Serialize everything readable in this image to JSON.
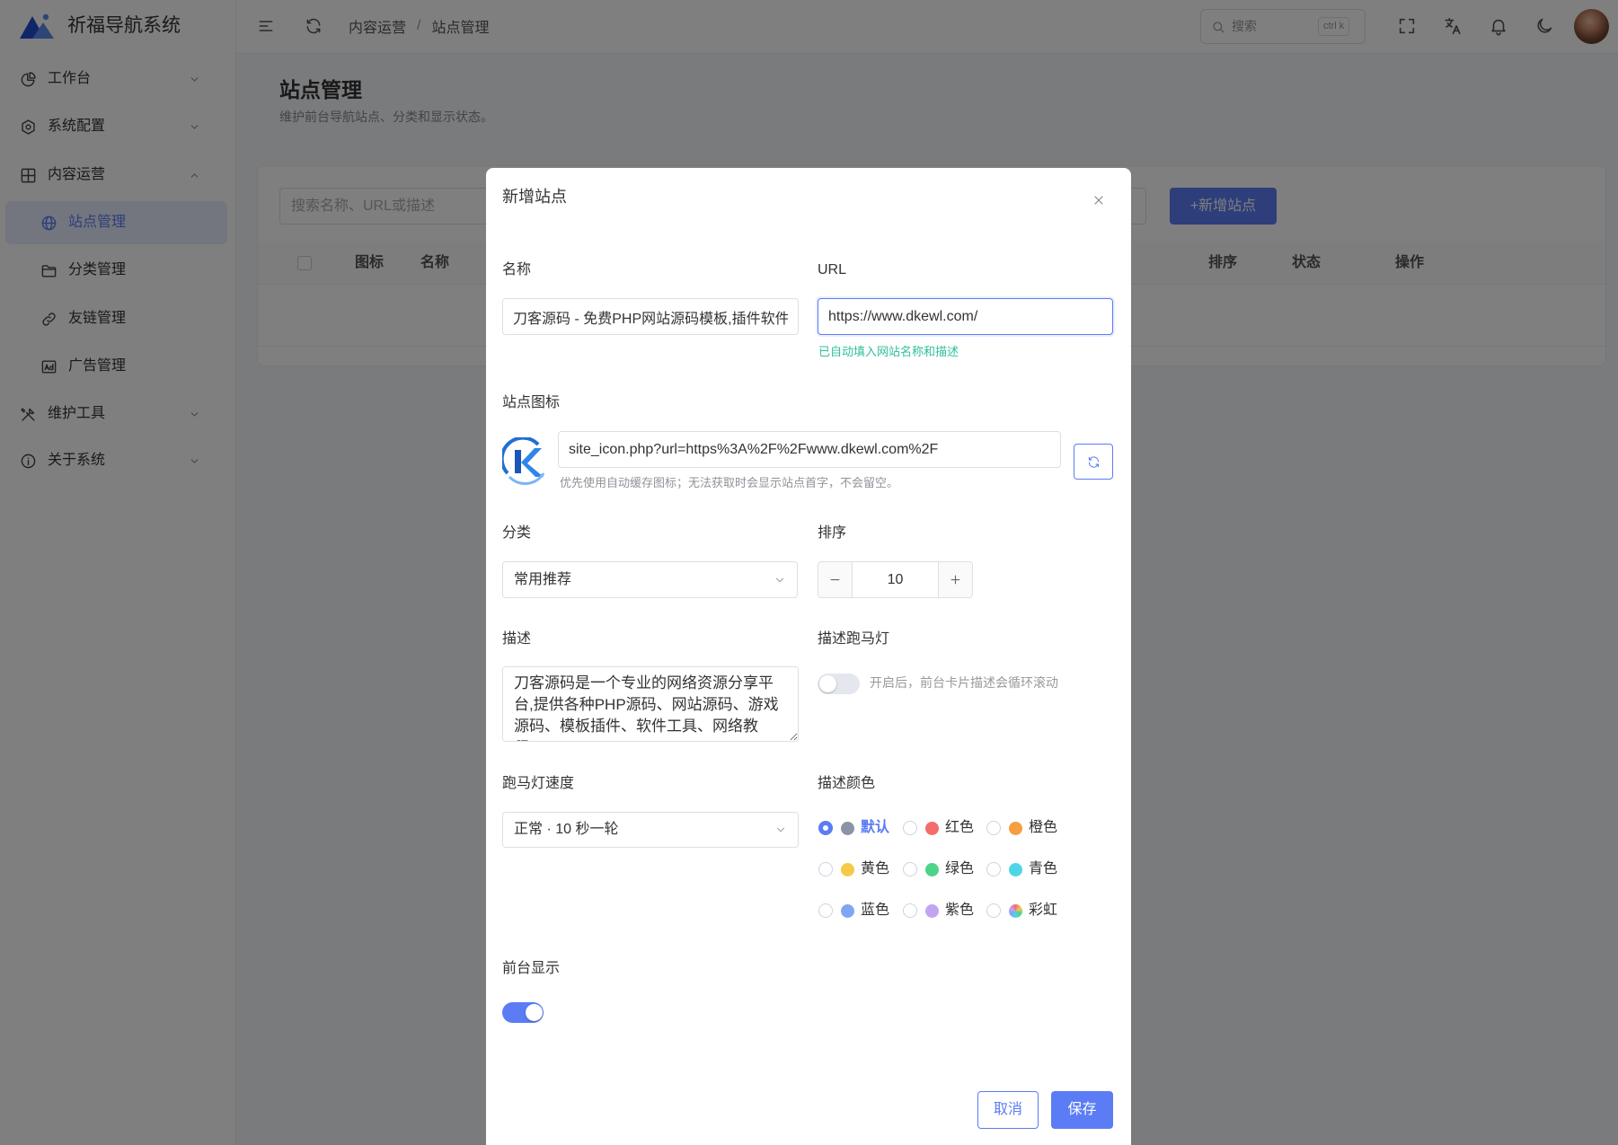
{
  "app": {
    "title": "祈福导航系统"
  },
  "sidebar": {
    "items": [
      {
        "label": "工作台",
        "icon": "dashboard-icon"
      },
      {
        "label": "系统配置",
        "icon": "gear-icon"
      },
      {
        "label": "内容运营",
        "icon": "grid-icon",
        "expanded": true,
        "children": [
          {
            "label": "站点管理",
            "icon": "globe-icon",
            "active": true
          },
          {
            "label": "分类管理",
            "icon": "folder-icon"
          },
          {
            "label": "友链管理",
            "icon": "link-icon"
          },
          {
            "label": "广告管理",
            "icon": "ad-icon"
          }
        ]
      },
      {
        "label": "维护工具",
        "icon": "tools-icon"
      },
      {
        "label": "关于系统",
        "icon": "info-icon"
      }
    ]
  },
  "header": {
    "breadcrumb": [
      "内容运营",
      "站点管理"
    ],
    "search_placeholder": "搜索",
    "search_shortcut": "ctrl k"
  },
  "page": {
    "title": "站点管理",
    "subtitle": "维护前台导航站点、分类和显示状态。",
    "search_placeholder": "搜索名称、URL或描述",
    "add_button": "+新增站点",
    "table_columns": [
      "图标",
      "名称",
      "排序",
      "状态",
      "操作"
    ]
  },
  "modal": {
    "title": "新增站点",
    "fields": {
      "name": {
        "label": "名称",
        "value": "刀客源码 - 免费PHP网站源码模板,插件软件"
      },
      "url": {
        "label": "URL",
        "value": "https://www.dkewl.com/",
        "hint": "已自动填入网站名称和描述"
      },
      "icon": {
        "label": "站点图标",
        "value": "site_icon.php?url=https%3A%2F%2Fwww.dkewl.com%2F",
        "hint": "优先使用自动缓存图标；无法获取时会显示站点首字，不会留空。"
      },
      "category": {
        "label": "分类",
        "value": "常用推荐"
      },
      "sort": {
        "label": "排序",
        "value": 10
      },
      "description": {
        "label": "描述",
        "value": "刀客源码是一个专业的网络资源分享平台,提供各种PHP源码、网站源码、游戏源码、模板插件、软件工具、网络教程、"
      },
      "marquee": {
        "label": "描述跑马灯",
        "enabled": false,
        "hint": "开启后，前台卡片描述会循环滚动"
      },
      "marquee_speed": {
        "label": "跑马灯速度",
        "value": "正常 · 10 秒一轮"
      },
      "desc_color": {
        "label": "描述颜色",
        "selected": "默认",
        "options": [
          {
            "label": "默认",
            "color": "#8a94a6"
          },
          {
            "label": "红色",
            "color": "#f56c6c"
          },
          {
            "label": "橙色",
            "color": "#f59e42"
          },
          {
            "label": "黄色",
            "color": "#f7c94b"
          },
          {
            "label": "绿色",
            "color": "#4ed38a"
          },
          {
            "label": "青色",
            "color": "#4dd6e8"
          },
          {
            "label": "蓝色",
            "color": "#7ea6f5"
          },
          {
            "label": "紫色",
            "color": "#c3a4f2"
          },
          {
            "label": "彩虹",
            "color": "rainbow"
          }
        ]
      },
      "visible": {
        "label": "前台显示",
        "enabled": true
      }
    },
    "buttons": {
      "cancel": "取消",
      "save": "保存"
    }
  },
  "colors": {
    "primary": "#5b7cf5",
    "hint_green": "#2fbf9b",
    "overlay": "#000000"
  }
}
